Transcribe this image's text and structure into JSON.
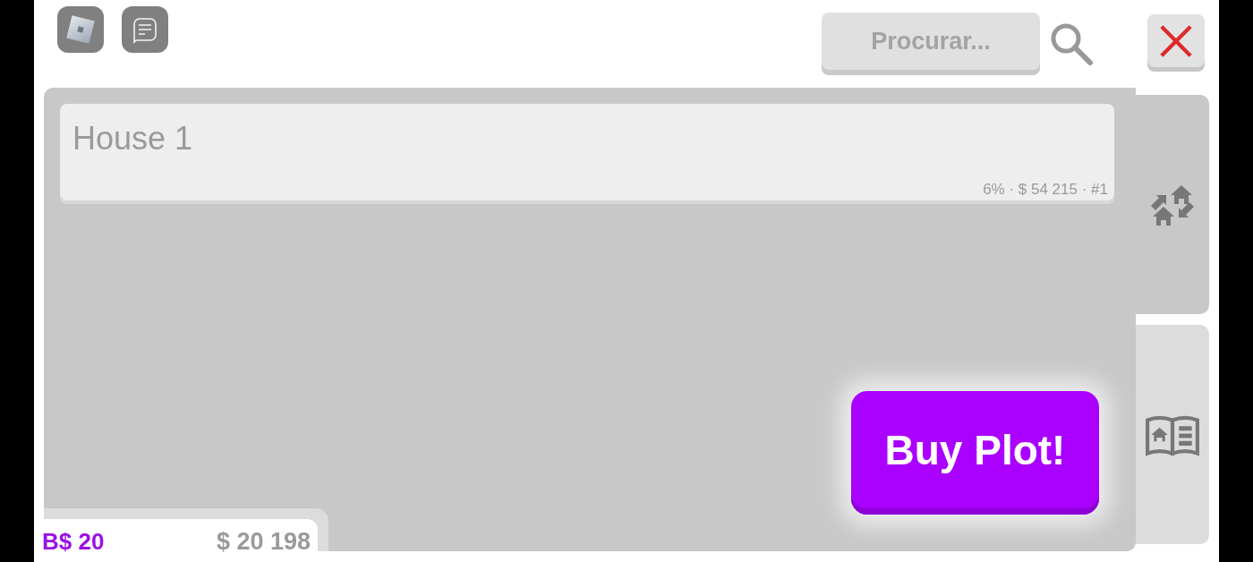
{
  "search": {
    "placeholder": "Procurar..."
  },
  "plot": {
    "name": "House 1",
    "info": "6% · $ 54 215 · #1"
  },
  "side_tabs": [
    {
      "kind": "plots",
      "selected": true
    },
    {
      "kind": "guide",
      "selected": false
    }
  ],
  "buy_button": "Buy Plot!",
  "wallet": {
    "robux": "B$ 20",
    "cash": "$ 20 198"
  }
}
